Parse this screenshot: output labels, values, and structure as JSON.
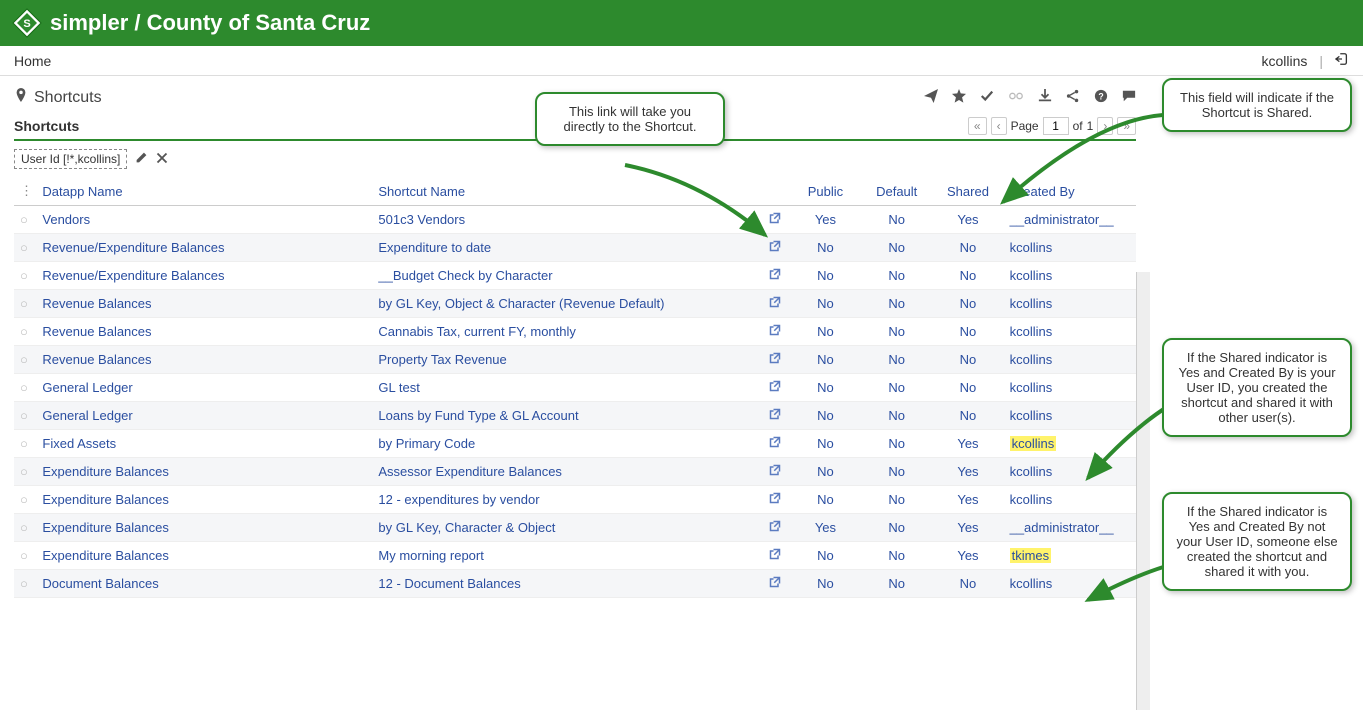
{
  "header": {
    "brand": "simpler",
    "org": "County of Santa Cruz"
  },
  "breadcrumb": {
    "home": "Home",
    "user": "kcollins"
  },
  "page": {
    "title": "Shortcuts",
    "subtitle": "Shortcuts"
  },
  "pager": {
    "label_page": "Page",
    "current": "1",
    "label_of": "of",
    "total": "1"
  },
  "filter": {
    "chip": "User Id [!*,kcollins]"
  },
  "columns": {
    "datapp": "Datapp Name",
    "shortcut": "Shortcut Name",
    "public": "Public",
    "default": "Default",
    "shared": "Shared",
    "created": "Created By"
  },
  "rows": [
    {
      "datapp": "Vendors",
      "name": "501c3 Vendors",
      "public": "Yes",
      "default": "No",
      "shared": "Yes",
      "created": "__administrator__",
      "hl": false
    },
    {
      "datapp": "Revenue/Expenditure Balances",
      "name": "Expenditure to date",
      "public": "No",
      "default": "No",
      "shared": "No",
      "created": "kcollins",
      "hl": false
    },
    {
      "datapp": "Revenue/Expenditure Balances",
      "name": "__Budget Check by Character",
      "public": "No",
      "default": "No",
      "shared": "No",
      "created": "kcollins",
      "hl": false
    },
    {
      "datapp": "Revenue Balances",
      "name": "by GL Key, Object & Character (Revenue Default)",
      "public": "No",
      "default": "No",
      "shared": "No",
      "created": "kcollins",
      "hl": false
    },
    {
      "datapp": "Revenue Balances",
      "name": "Cannabis Tax, current FY, monthly",
      "public": "No",
      "default": "No",
      "shared": "No",
      "created": "kcollins",
      "hl": false
    },
    {
      "datapp": "Revenue Balances",
      "name": "Property Tax Revenue",
      "public": "No",
      "default": "No",
      "shared": "No",
      "created": "kcollins",
      "hl": false
    },
    {
      "datapp": "General Ledger",
      "name": "GL test",
      "public": "No",
      "default": "No",
      "shared": "No",
      "created": "kcollins",
      "hl": false
    },
    {
      "datapp": "General Ledger",
      "name": "Loans by Fund Type & GL Account",
      "public": "No",
      "default": "No",
      "shared": "No",
      "created": "kcollins",
      "hl": false
    },
    {
      "datapp": "Fixed Assets",
      "name": "by Primary Code",
      "public": "No",
      "default": "No",
      "shared": "Yes",
      "created": "kcollins",
      "hl": true
    },
    {
      "datapp": "Expenditure Balances",
      "name": "Assessor Expenditure Balances",
      "public": "No",
      "default": "No",
      "shared": "Yes",
      "created": "kcollins",
      "hl": false
    },
    {
      "datapp": "Expenditure Balances",
      "name": "12 - expenditures by vendor",
      "public": "No",
      "default": "No",
      "shared": "Yes",
      "created": "kcollins",
      "hl": false
    },
    {
      "datapp": "Expenditure Balances",
      "name": "by GL Key, Character & Object",
      "public": "Yes",
      "default": "No",
      "shared": "Yes",
      "created": "__administrator__",
      "hl": false
    },
    {
      "datapp": "Expenditure Balances",
      "name": "My morning report",
      "public": "No",
      "default": "No",
      "shared": "Yes",
      "created": "tkimes",
      "hl": true
    },
    {
      "datapp": "Document Balances",
      "name": "12 - Document Balances",
      "public": "No",
      "default": "No",
      "shared": "No",
      "created": "kcollins",
      "hl": false
    }
  ],
  "callouts": {
    "c1": "This link will take you directly to the Shortcut.",
    "c2": "This field will indicate if the Shortcut is Shared.",
    "c3": "If the Shared indicator is Yes and Created By is your User ID, you created the shortcut and shared it with other user(s).",
    "c4": "If the Shared indicator is Yes and Created By not your User ID, someone else created the shortcut and shared it with you."
  }
}
